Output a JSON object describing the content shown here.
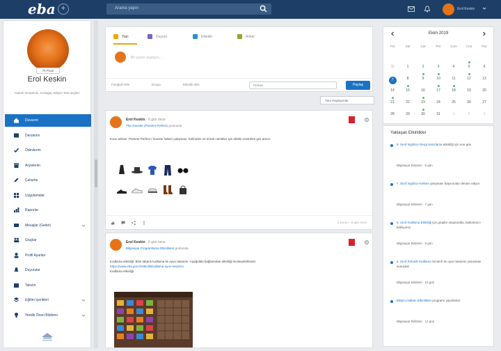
{
  "header": {
    "logo": "eba",
    "logo_plus": "+",
    "search_placeholder": "Arama yapın",
    "user_label": "Erol Keskin"
  },
  "profile": {
    "badge": "75 Puan",
    "name": "Erol Keskin",
    "bio": "Atatürk Ortaokulu, Kırkağaç Bilişim Teknolojileri"
  },
  "sidebar": {
    "items": [
      {
        "label": "Duvarım",
        "icon": "home-icon",
        "active": true
      },
      {
        "label": "Derslerim",
        "icon": "book-icon"
      },
      {
        "label": "Ödevlerim",
        "icon": "check-icon"
      },
      {
        "label": "Arşivlerim",
        "icon": "archive-icon"
      },
      {
        "label": "Çalışma",
        "icon": "pencil-icon"
      },
      {
        "label": "Uygulamalar",
        "icon": "apps-icon"
      },
      {
        "label": "Raporlar",
        "icon": "chart-icon"
      },
      {
        "label": "Mesajlar (Gelen)",
        "icon": "mail-icon",
        "caret": true
      },
      {
        "label": "Gruplar",
        "icon": "users-icon"
      },
      {
        "label": "Profil Ayarları",
        "icon": "user-icon"
      },
      {
        "label": "Duyurular",
        "icon": "bell-icon"
      },
      {
        "label": "Takvim",
        "icon": "calendar-icon"
      },
      {
        "label": "Eğitim İçerikleri",
        "icon": "layers-icon",
        "caret": true
      },
      {
        "label": "Yenilik Öneri Bildirimi",
        "icon": "lightbulb-icon",
        "caret": true
      }
    ]
  },
  "composer": {
    "tabs": [
      {
        "label": "Yazı",
        "color": "#f0a500"
      },
      {
        "label": "Duyuru",
        "color": "#7b61c9"
      },
      {
        "label": "Etkinlik",
        "color": "#2b8dd6"
      },
      {
        "label": "Anket",
        "color": "#8aaa2a"
      }
    ],
    "placeholder": "Bir şeyler paylaşın...",
    "actions": [
      "Fotoğraf ekle",
      "Dosya",
      "Etkinlik ekle"
    ],
    "audience": "Herkes",
    "send_label": "Paylaş"
  },
  "filter_label": "Tüm Paylaşımlar",
  "posts": [
    {
      "author": "Erol Keskin",
      "time_short": "· 6 gün önce",
      "group": "The Gazette (Present Perfect)",
      "group_suffix": "grubunda",
      "body": "Konu tekrarı: Present Perfect / Gazete haberi çalışması. Kelimeler ve örnek cümleler için ekteki resimlere göz atınız.",
      "footer": "3 yorum · 6 gün önce"
    },
    {
      "author": "Erol Keskin",
      "time_short": "· 6 gün önce",
      "group": "Bilgisayar Programlama Etkinlikleri",
      "group_suffix": "grubunda",
      "body": "Kodlama etkinliği: Blok tabanlı kodlama ile oyun tasarımı. Aşağıdaki bağlantıdan etkinliği inceleyebilirsiniz.",
      "link": "https://www.eba.gov.tr/etkinlik/kodlama-oyun-tasarimi",
      "extra": "Kodlama etkinliği"
    }
  ],
  "calendar": {
    "title": "Ekim 2019",
    "days_of_week": [
      "Pzt",
      "Sal",
      "Çar",
      "Per",
      "Cum",
      "Cmt",
      "Paz"
    ],
    "weeks": [
      [
        "30",
        "1",
        "2",
        "3",
        "4",
        "5",
        "6"
      ],
      [
        "7",
        "8",
        "9",
        "10",
        "11",
        "12",
        "13"
      ],
      [
        "14",
        "15",
        "16",
        "17",
        "18",
        "19",
        "20"
      ],
      [
        "21",
        "22",
        "23",
        "24",
        "25",
        "26",
        "27"
      ],
      [
        "28",
        "29",
        "30",
        "31",
        "1",
        "2",
        "3"
      ]
    ]
  },
  "events": {
    "title": "Yaklaşan Etkinlikler",
    "items": [
      {
        "link": "8. Sınıf İngilizce Dergi Hazırlama",
        "text": "etkinliği için son gün",
        "meta": "Bilgisayar Bilimleri · 6 gün"
      },
      {
        "link": "7. Sınıf İngilizce Kelime",
        "text": "yarışması başvuruları devam ediyor",
        "meta": "Bilgisayar Bilimleri · 7 gün"
      },
      {
        "link": "5. Sınıf Kodlama Etkinliği",
        "text": "için gruplar oluşturuldu, katılımınızı bekliyoruz",
        "meta": "Bilgisayar Bilimleri · 8 gün"
      },
      {
        "link": "6. Sınıf Robotik Kodlama",
        "text": "Scratch ile oyun tasarımı yarışması sonuçları",
        "meta": "Bilgisayar Bilimleri · 10 gün"
      },
      {
        "link": "Bilişim Haftası Etkinlikleri",
        "text": "programı yayınlandı",
        "meta": "Bilgisayar Bilimleri · 12 gün"
      }
    ]
  }
}
